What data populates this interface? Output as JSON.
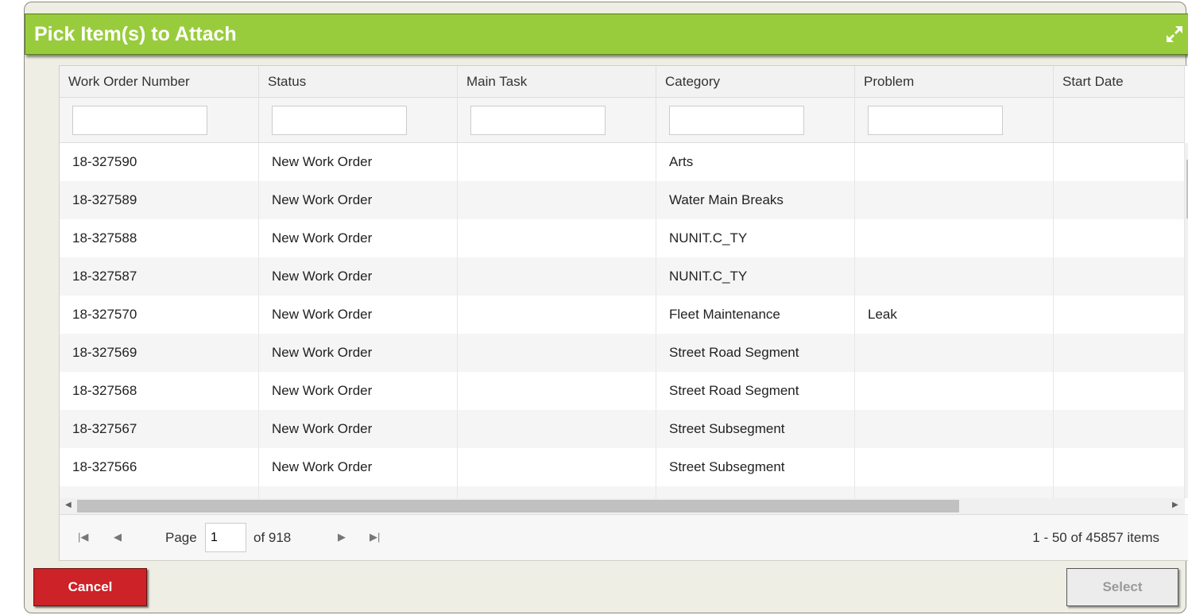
{
  "dialog": {
    "title": "Pick Item(s) to Attach",
    "expand_icon": "expand-arrows-icon"
  },
  "grid": {
    "columns": [
      "Work Order Number",
      "Status",
      "Main Task",
      "Category",
      "Problem",
      "Start Date"
    ],
    "rows": [
      [
        "18-327590",
        "New Work Order",
        "",
        "Arts",
        "",
        ""
      ],
      [
        "18-327589",
        "New Work Order",
        "",
        "Water Main Breaks",
        "",
        ""
      ],
      [
        "18-327588",
        "New Work Order",
        "",
        "NUNIT.C_TY",
        "",
        ""
      ],
      [
        "18-327587",
        "New Work Order",
        "",
        "NUNIT.C_TY",
        "",
        ""
      ],
      [
        "18-327570",
        "New Work Order",
        "",
        "Fleet Maintenance",
        "Leak",
        ""
      ],
      [
        "18-327569",
        "New Work Order",
        "",
        "Street Road Segment",
        "",
        ""
      ],
      [
        "18-327568",
        "New Work Order",
        "",
        "Street Road Segment",
        "",
        ""
      ],
      [
        "18-327567",
        "New Work Order",
        "",
        "Street Subsegment",
        "",
        ""
      ],
      [
        "18-327566",
        "New Work Order",
        "",
        "Street Subsegment",
        "",
        ""
      ]
    ]
  },
  "pager": {
    "page_label": "Page",
    "page_value": "1",
    "of_label": "of 918",
    "items_label": "1 - 50 of 45857 items"
  },
  "buttons": {
    "cancel": "Cancel",
    "select": "Select"
  },
  "colors": {
    "title_bar": "#99cc3d",
    "cancel": "#cc2228"
  }
}
